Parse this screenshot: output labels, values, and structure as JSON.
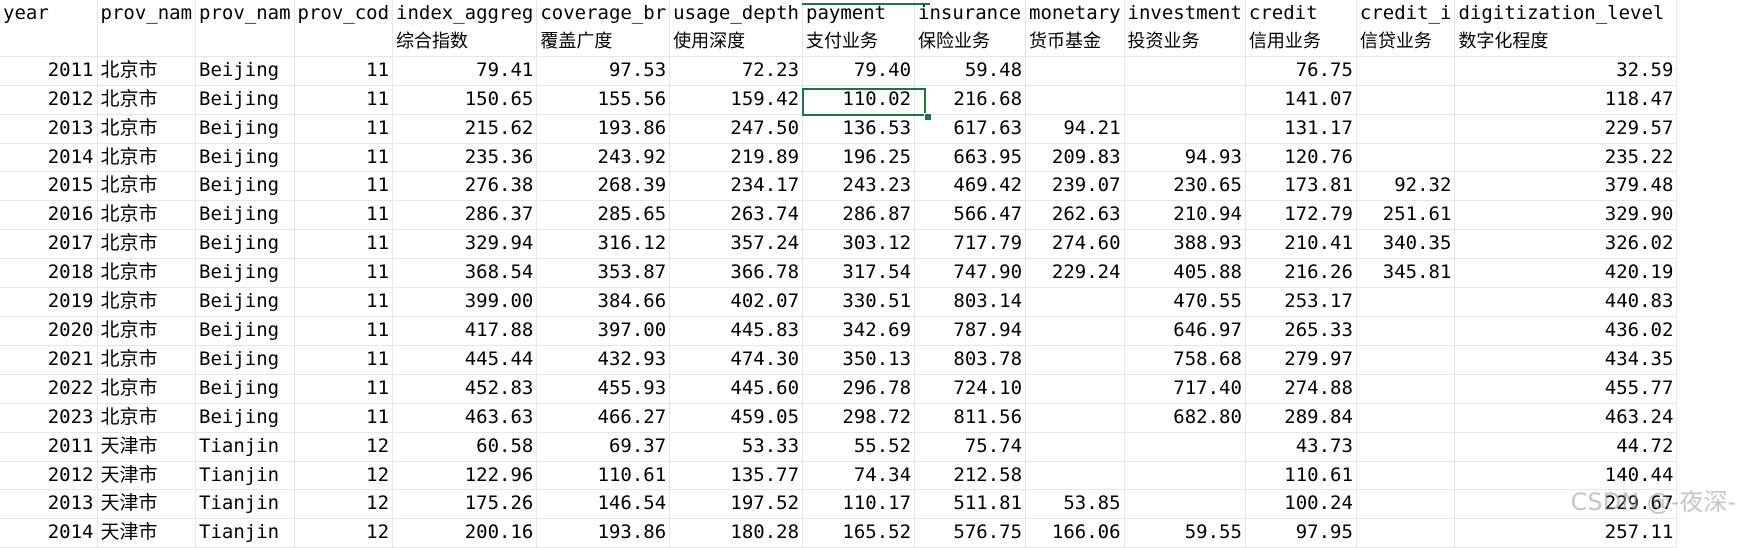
{
  "sheet": {
    "headers_row1": [
      "year",
      "prov_nam",
      "prov_nam",
      "prov_cod",
      "index_aggreg",
      "coverage_br",
      "usage_depth",
      "payment",
      "insurance",
      "monetary",
      "investment",
      "credit",
      "credit_i",
      "digitization_level"
    ],
    "headers_row2": [
      "",
      "",
      "",
      "",
      "综合指数",
      "覆盖广度",
      "使用深度",
      "支付业务",
      "保险业务",
      "货币基金",
      "投资业务",
      "信用业务",
      "信贷业务",
      "数字化程度"
    ],
    "rows": [
      [
        "2011",
        "北京市",
        "Beijing",
        "11",
        "79.41",
        "97.53",
        "72.23",
        "79.40",
        "59.48",
        "",
        "",
        "76.75",
        "",
        "32.59"
      ],
      [
        "2012",
        "北京市",
        "Beijing",
        "11",
        "150.65",
        "155.56",
        "159.42",
        "110.02",
        "216.68",
        "",
        "",
        "141.07",
        "",
        "118.47"
      ],
      [
        "2013",
        "北京市",
        "Beijing",
        "11",
        "215.62",
        "193.86",
        "247.50",
        "136.53",
        "617.63",
        "94.21",
        "",
        "131.17",
        "",
        "229.57"
      ],
      [
        "2014",
        "北京市",
        "Beijing",
        "11",
        "235.36",
        "243.92",
        "219.89",
        "196.25",
        "663.95",
        "209.83",
        "94.93",
        "120.76",
        "",
        "235.22"
      ],
      [
        "2015",
        "北京市",
        "Beijing",
        "11",
        "276.38",
        "268.39",
        "234.17",
        "243.23",
        "469.42",
        "239.07",
        "230.65",
        "173.81",
        "92.32",
        "379.48"
      ],
      [
        "2016",
        "北京市",
        "Beijing",
        "11",
        "286.37",
        "285.65",
        "263.74",
        "286.87",
        "566.47",
        "262.63",
        "210.94",
        "172.79",
        "251.61",
        "329.90"
      ],
      [
        "2017",
        "北京市",
        "Beijing",
        "11",
        "329.94",
        "316.12",
        "357.24",
        "303.12",
        "717.79",
        "274.60",
        "388.93",
        "210.41",
        "340.35",
        "326.02"
      ],
      [
        "2018",
        "北京市",
        "Beijing",
        "11",
        "368.54",
        "353.87",
        "366.78",
        "317.54",
        "747.90",
        "229.24",
        "405.88",
        "216.26",
        "345.81",
        "420.19"
      ],
      [
        "2019",
        "北京市",
        "Beijing",
        "11",
        "399.00",
        "384.66",
        "402.07",
        "330.51",
        "803.14",
        "",
        "470.55",
        "253.17",
        "",
        "440.83"
      ],
      [
        "2020",
        "北京市",
        "Beijing",
        "11",
        "417.88",
        "397.00",
        "445.83",
        "342.69",
        "787.94",
        "",
        "646.97",
        "265.33",
        "",
        "436.02"
      ],
      [
        "2021",
        "北京市",
        "Beijing",
        "11",
        "445.44",
        "432.93",
        "474.30",
        "350.13",
        "803.78",
        "",
        "758.68",
        "279.97",
        "",
        "434.35"
      ],
      [
        "2022",
        "北京市",
        "Beijing",
        "11",
        "452.83",
        "455.93",
        "445.60",
        "296.78",
        "724.10",
        "",
        "717.40",
        "274.88",
        "",
        "455.77"
      ],
      [
        "2023",
        "北京市",
        "Beijing",
        "11",
        "463.63",
        "466.27",
        "459.05",
        "298.72",
        "811.56",
        "",
        "682.80",
        "289.84",
        "",
        "463.24"
      ],
      [
        "2011",
        "天津市",
        "Tianjin",
        "12",
        "60.58",
        "69.37",
        "53.33",
        "55.52",
        "75.74",
        "",
        "",
        "43.73",
        "",
        "44.72"
      ],
      [
        "2012",
        "天津市",
        "Tianjin",
        "12",
        "122.96",
        "110.61",
        "135.77",
        "74.34",
        "212.58",
        "",
        "",
        "110.61",
        "",
        "140.44"
      ],
      [
        "2013",
        "天津市",
        "Tianjin",
        "12",
        "175.26",
        "146.54",
        "197.52",
        "110.17",
        "511.81",
        "53.85",
        "",
        "100.24",
        "",
        "229.67"
      ],
      [
        "2014",
        "天津市",
        "Tianjin",
        "12",
        "200.16",
        "193.86",
        "180.28",
        "165.52",
        "576.75",
        "166.06",
        "59.55",
        "97.95",
        "",
        "257.11"
      ]
    ]
  },
  "watermark": "CSDN @-夜深-"
}
